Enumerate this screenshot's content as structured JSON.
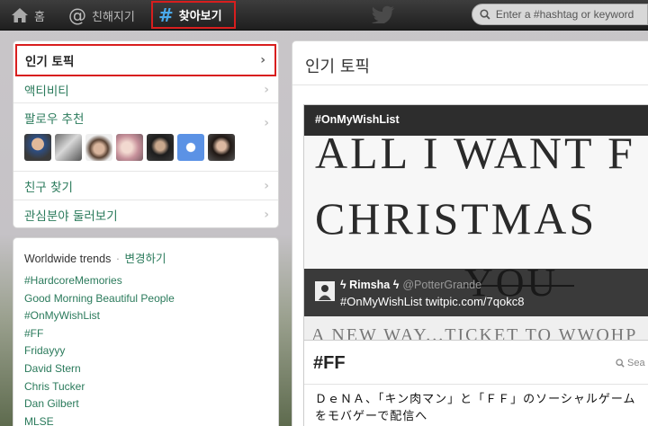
{
  "topbar": {
    "home_label": "홈",
    "connect_label": "친해지기",
    "discover_label": "찾아보기",
    "search_placeholder": "Enter a #hashtag or keyword"
  },
  "left_nav": {
    "items": [
      {
        "label": "인기 토픽",
        "active": true
      },
      {
        "label": "액티비티"
      },
      {
        "label": "팔로우 추천"
      },
      {
        "label": "친구 찾기"
      },
      {
        "label": "관심분야 둘러보기"
      }
    ]
  },
  "trends": {
    "heading": "Worldwide trends",
    "separator": "·",
    "change_label": "변경하기",
    "items": [
      "#HardcoreMemories",
      "Good Morning Beautiful People",
      "#OnMyWishList",
      "#FF",
      "Fridayyy",
      "David Stern",
      "Chris Tucker",
      "Dan Gilbert",
      "MLSE"
    ]
  },
  "main": {
    "title": "인기 토픽",
    "story": {
      "hashtag": "#OnMyWishList",
      "image_lines": [
        "ALL I WANT F",
        "CHRISTMAS",
        "YOU"
      ],
      "tweet_user": "ϟ Rimsha ϟ",
      "tweet_handle": "@PotterGrande",
      "tweet_text": "#OnMyWishList twitpic.com/7qokc8"
    },
    "ff": {
      "title": "#FF",
      "search_label": "Sea",
      "tweet_text": "ＤｅＮＡ、「キン肉マン」と「ＦＦ」のソーシャルゲームをモバゲーで配信へ"
    }
  },
  "colors": {
    "accent_green": "#2a7a5b",
    "highlight_red": "#d81e1e",
    "topbar_dark": "#1f1f1f"
  }
}
